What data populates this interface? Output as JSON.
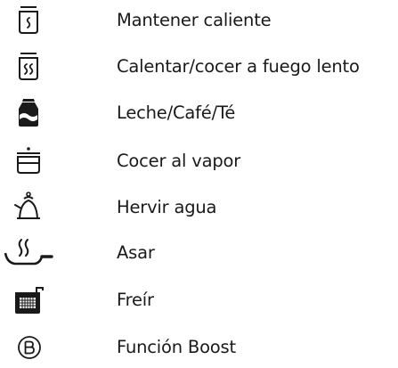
{
  "functions": [
    {
      "label": "Mantener caliente",
      "icon": "keep-warm-pot-icon"
    },
    {
      "label": "Calentar/cocer a fuego lento",
      "icon": "simmer-pot-icon"
    },
    {
      "label": "Leche/Café/Té",
      "icon": "milk-carton-icon"
    },
    {
      "label": "Cocer al vapor",
      "icon": "steamer-pot-icon"
    },
    {
      "label": "Hervir agua",
      "icon": "kettle-icon"
    },
    {
      "label": "Asar",
      "icon": "frying-pan-icon"
    },
    {
      "label": "Freír",
      "icon": "deep-fryer-icon"
    },
    {
      "label": "Función Boost",
      "icon": "boost-b-icon"
    }
  ],
  "colors": {
    "icon": "#1a1a1a",
    "text": "#1a1a1a",
    "background": "#ffffff"
  }
}
